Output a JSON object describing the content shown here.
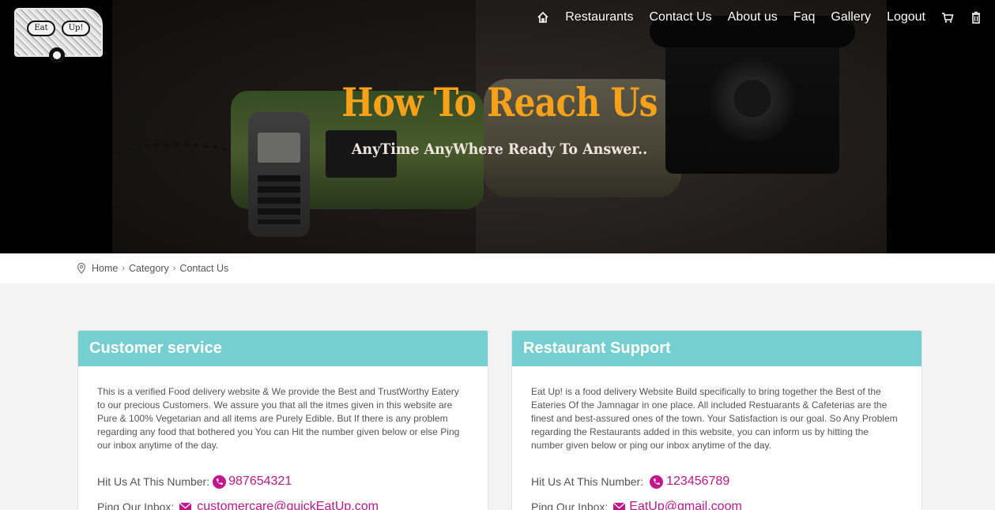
{
  "logo": {
    "left_text": "Eat",
    "right_text": "Up!"
  },
  "nav": {
    "home_icon": "home-icon",
    "items": [
      "Restaurants",
      "Contact Us",
      "About us",
      "Faq",
      "Gallery",
      "Logout"
    ],
    "cart_icon": "cart-icon",
    "trash_icon": "trash-icon"
  },
  "hero": {
    "title": "How To Reach Us",
    "subtitle": "AnyTime AnyWhere Ready To Answer.."
  },
  "breadcrumb": {
    "icon": "location-pin-icon",
    "items": [
      "Home",
      "Category",
      "Contact Us"
    ]
  },
  "cards": [
    {
      "title": "Customer service",
      "text": "This is a verified Food delivery website & We provide the Best and TrustWorthy Eatery to our precious Customers. We assure you that all the itmes given in this website are Pure & 100% Vegetarian and all items are Purely Edible. But If there is any problem regarding any food that bothered you You can Hit the number given below or else Ping our inbox anytime of the day.",
      "phone_label": "Hit Us At This Number:",
      "phone": "987654321",
      "inbox_label": "Ping Our Inbox:",
      "email": "customercare@quickEatUp.com"
    },
    {
      "title": "Restaurant Support",
      "text": "Eat Up! is a food delivery Website Build specifically to bring together the Best of the Eateries Of the Jamnagar in one place. All included Restuarants & Cafeterias are the finest and best-assured ones of the town. Your Satisfaction is our goal. So Any Problem regarding the Restaurants added in this website, you can inform us by hitting the number given below or ping our inbox anytime of the day.",
      "phone_label": "Hit Us At This Number:",
      "phone": "123456789",
      "inbox_label": "Ping Our Inbox:",
      "email": "EatUp@gmail.coom"
    }
  ],
  "colors": {
    "accent_teal": "#75cfd0",
    "title_orange": "#f6a11a",
    "link_magenta": "#c2168e"
  }
}
